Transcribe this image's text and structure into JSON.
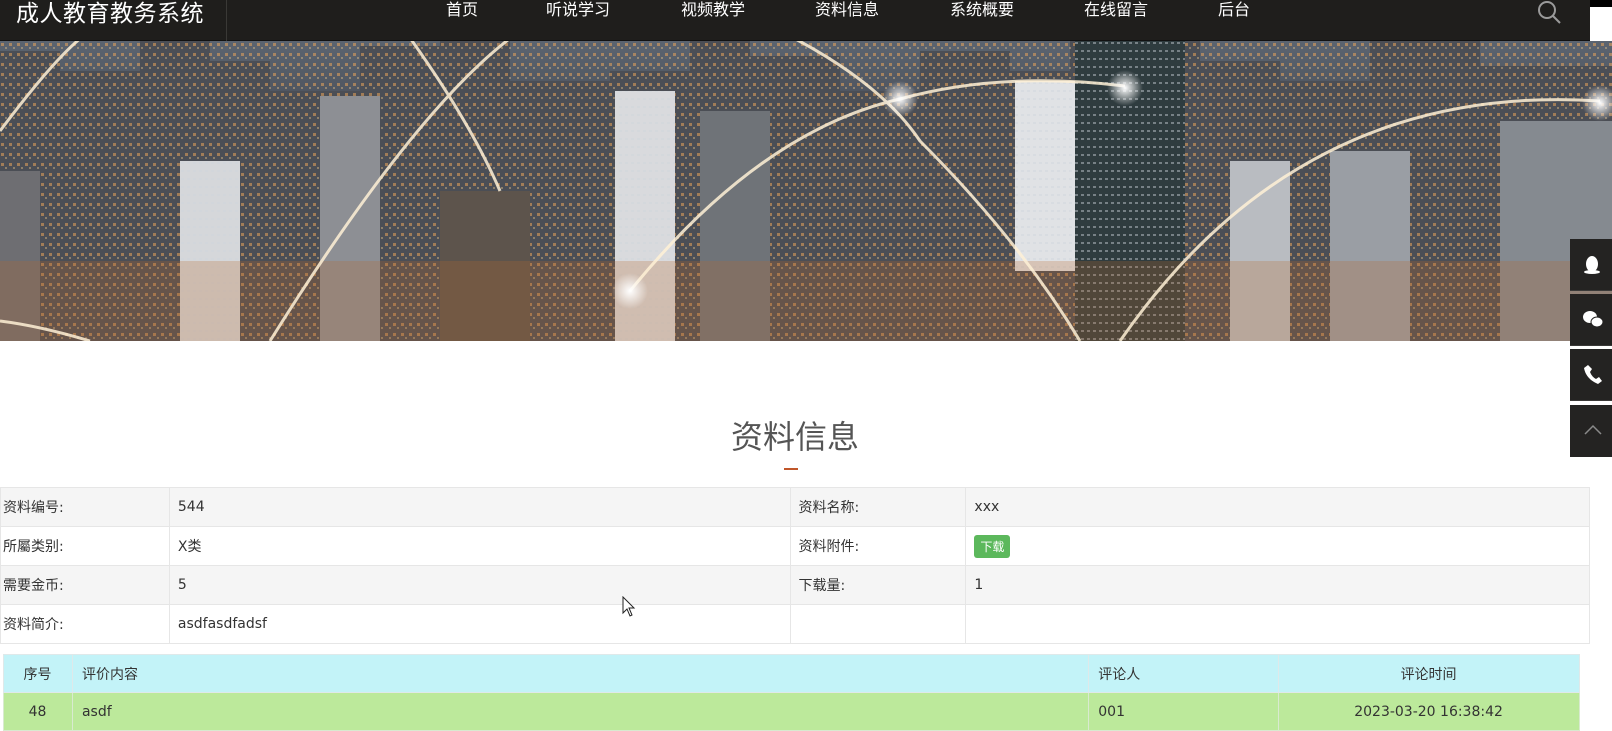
{
  "header": {
    "logo": "成人教育教务系统",
    "nav": [
      "首页",
      "听说学习",
      "视频教学",
      "资料信息",
      "系统概要",
      "在线留言",
      "后台"
    ]
  },
  "section": {
    "title": "资料信息"
  },
  "detail": {
    "rows": [
      [
        {
          "label": "资料编号:",
          "value": "544"
        },
        {
          "label": "资料名称:",
          "value": "xxx"
        }
      ],
      [
        {
          "label": "所屬类别:",
          "value": "X类"
        },
        {
          "label": "资料附件:",
          "value": "下载"
        }
      ],
      [
        {
          "label": "需要金币:",
          "value": "5"
        },
        {
          "label": "下载量:",
          "value": "1"
        }
      ],
      [
        {
          "label": "资料简介:",
          "value": "asdfasdfadsf"
        },
        {
          "label": "",
          "value": ""
        }
      ]
    ]
  },
  "comments": {
    "headers": [
      "序号",
      "评价内容",
      "评论人",
      "评论时间"
    ],
    "rows": [
      [
        "48",
        "asdf",
        "001",
        "2023-03-20 16:38:42"
      ]
    ]
  },
  "colors": {
    "topbar": "#1f1e1c",
    "accent_underline": "#c0562a",
    "download_badge": "#5cb85c",
    "comment_header": "#c3f3f8",
    "comment_row": "#bce99b"
  }
}
